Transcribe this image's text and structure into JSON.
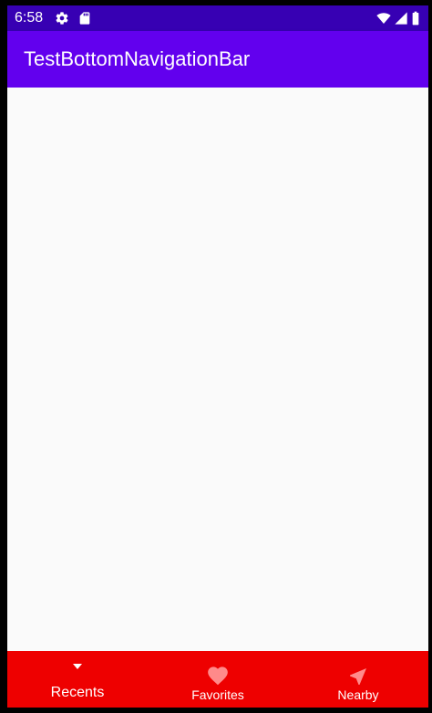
{
  "status_bar": {
    "time": "6:58",
    "icons": [
      "gear-icon",
      "sd-card-icon",
      "wifi-icon",
      "signal-icon",
      "battery-icon"
    ]
  },
  "app_bar": {
    "title": "TestBottomNavigationBar"
  },
  "bottom_nav": {
    "items": [
      {
        "label": "Recents",
        "icon": "chevron-down-icon",
        "selected": true
      },
      {
        "label": "Favorites",
        "icon": "heart-icon",
        "selected": false
      },
      {
        "label": "Nearby",
        "icon": "navigation-arrow-icon",
        "selected": false
      }
    ]
  },
  "colors": {
    "status_bar": "#3700b3",
    "app_bar": "#6200ee",
    "bottom_nav": "#ee0000",
    "content_bg": "#fafafa",
    "inactive_icon": "#ff8a8a"
  }
}
